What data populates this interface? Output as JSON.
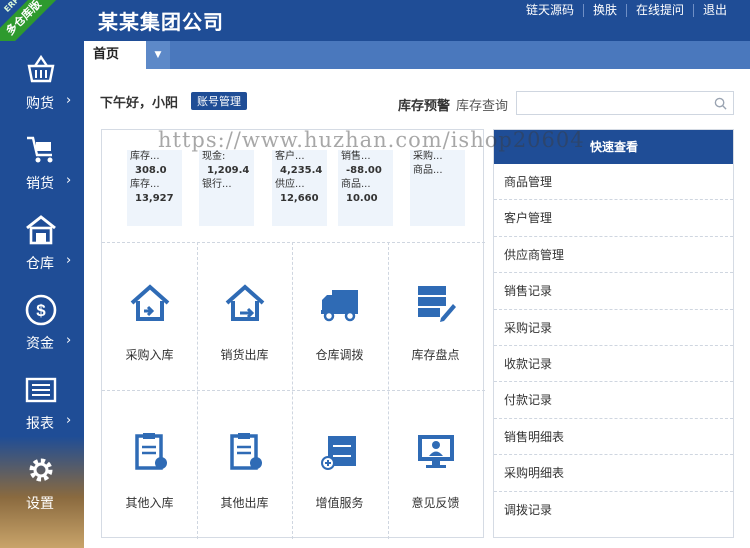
{
  "header": {
    "ribbon_small": "ERP",
    "ribbon_text": "多仓库版",
    "brand": "某某集团公司",
    "links": [
      "链天源码",
      "换肤",
      "在线提问",
      "退出"
    ]
  },
  "sidebar": {
    "items": [
      {
        "label": "购货",
        "icon": "basket-icon"
      },
      {
        "label": "销货",
        "icon": "cart-icon"
      },
      {
        "label": "仓库",
        "icon": "warehouse-icon"
      },
      {
        "label": "资金",
        "icon": "dollar-icon"
      },
      {
        "label": "报表",
        "icon": "report-icon"
      },
      {
        "label": "设置",
        "icon": "gear-icon"
      }
    ],
    "chevron": "›"
  },
  "tabs": {
    "home_label": "首页",
    "dropdown": "▼"
  },
  "greeting": {
    "text": "下午好，小阳",
    "account_button": "账号管理"
  },
  "inventory": {
    "warning_label": "库存预警",
    "query_label": "库存查询",
    "search_placeholder": "",
    "search_value": ""
  },
  "stats": [
    {
      "rows": [
        "库存...",
        "308.0",
        "库存...",
        "13,927"
      ]
    },
    {
      "rows": [
        "现金:",
        "1,209.4",
        "银行...",
        ""
      ]
    },
    {
      "rows": [
        "客户...",
        "4,235.4",
        "供应...",
        "12,660"
      ]
    },
    {
      "rows": [
        "销售...",
        "-88.00",
        "商品...",
        "10.00"
      ]
    },
    {
      "rows": [
        "采购...",
        "商品...",
        "",
        ""
      ]
    }
  ],
  "tiles": [
    {
      "label": "采购入库",
      "icon": "house-arrow-icon"
    },
    {
      "label": "销货出库",
      "icon": "house-forward-icon"
    },
    {
      "label": "仓库调拨",
      "icon": "truck-icon"
    },
    {
      "label": "库存盘点",
      "icon": "stack-edit-icon"
    },
    {
      "label": "其他入库",
      "icon": "clipboard-in-icon"
    },
    {
      "label": "其他出库",
      "icon": "clipboard-out-icon"
    },
    {
      "label": "增值服务",
      "icon": "cabinet-plus-icon"
    },
    {
      "label": "意见反馈",
      "icon": "monitor-user-icon"
    }
  ],
  "quick": {
    "title": "快速查看",
    "items": [
      "商品管理",
      "客户管理",
      "供应商管理",
      "销售记录",
      "采购记录",
      "收款记录",
      "付款记录",
      "销售明细表",
      "采购明细表",
      "调拨记录"
    ]
  },
  "watermark": "https://www.huzhan.com/ishop20604",
  "colors": {
    "primary": "#1f4d96",
    "tabbar": "#4a78bd",
    "icon_blue": "#2f6bb5",
    "ribbon": "#2e9a2e"
  }
}
